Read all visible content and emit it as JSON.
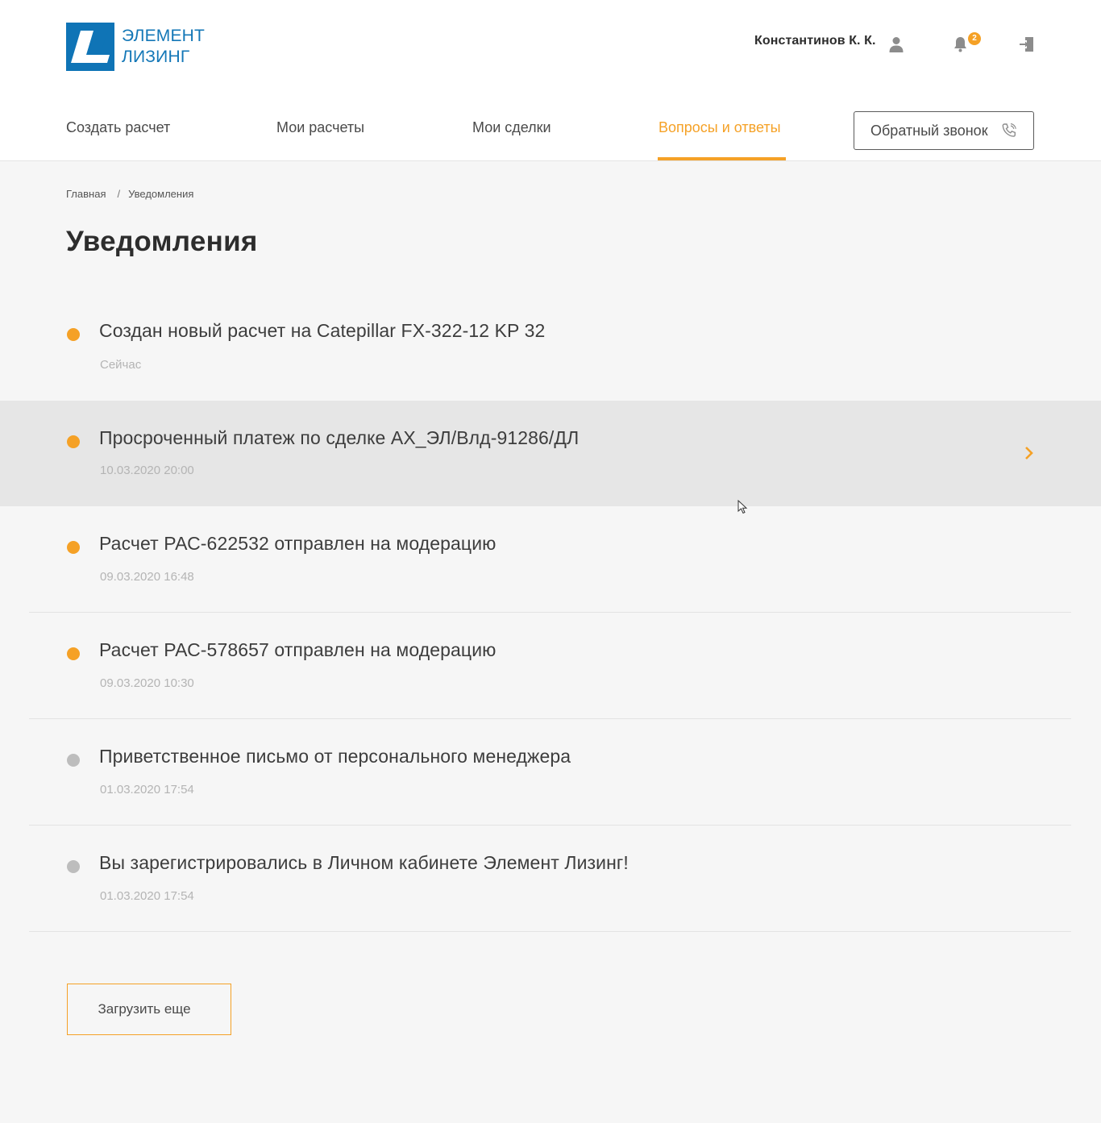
{
  "header": {
    "logo": {
      "line1": "ЭЛЕМЕНТ",
      "line2": "ЛИЗИНГ",
      "brand_color": "#0f74b6"
    },
    "user_name": "Константинов К. К.",
    "icons": {
      "user": "user-icon",
      "bell": "bell-icon",
      "logout": "logout-icon"
    },
    "notification_count": "2"
  },
  "nav": {
    "items": [
      {
        "label": "Создать расчет",
        "active": false
      },
      {
        "label": "Мои расчеты",
        "active": false
      },
      {
        "label": "Мои сделки",
        "active": false
      },
      {
        "label": "Вопросы и ответы",
        "active": true
      }
    ],
    "callback_label": "Обратный звонок",
    "accent": "#f5a126"
  },
  "breadcrumb": {
    "home": "Главная",
    "separator": "/",
    "current": "Уведомления"
  },
  "page_title": "Уведомления",
  "notifications": [
    {
      "title": "Создан новый расчет на Catepillar FX-322-12 KP 32",
      "time": "Сейчас",
      "status": "new"
    },
    {
      "title": "Просроченный платеж по сделке АХ_ЭЛ/Влд-91286/ДЛ",
      "time": "10.03.2020 20:00",
      "status": "new"
    },
    {
      "title": "Расчет РАС-622532 отправлен на модерацию",
      "time": "09.03.2020 16:48",
      "status": "new"
    },
    {
      "title": "Расчет РАС-578657 отправлен на модерацию",
      "time": "09.03.2020 10:30",
      "status": "new"
    },
    {
      "title": "Приветственное письмо от персонального менеджера",
      "time": "01.03.2020 17:54",
      "status": "read"
    },
    {
      "title": "Вы зарегистрировались в Личном кабинете Элемент Лизинг!",
      "time": "01.03.2020 17:54",
      "status": "read"
    }
  ],
  "load_more_label": "Загрузить еще"
}
